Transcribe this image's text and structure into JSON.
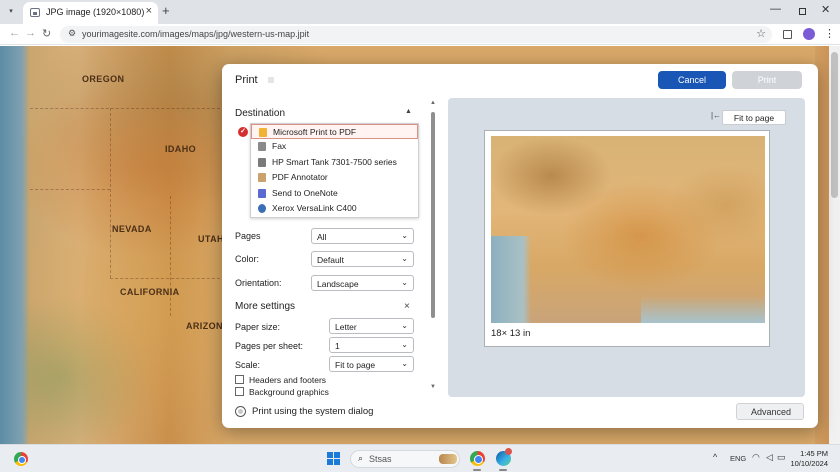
{
  "browser": {
    "tab_title": "JPG image (1920×1080)",
    "url": "yourimagesite.com/images/maps/jpg/western-us-map.jpit"
  },
  "map": {
    "states": [
      "OREGON",
      "IDAHO",
      "NEVADA",
      "UTAH",
      "CALIFORNIA",
      "ARIZONA"
    ]
  },
  "dialog": {
    "title": "Print",
    "cancel_label": "Cancel",
    "print_label": "Print",
    "destination": {
      "heading": "Destination",
      "items": [
        {
          "label": "Microsoft Print to PDF",
          "icon": "pdf-folder-icon",
          "color": "#f2b233"
        },
        {
          "label": "Fax",
          "icon": "fax-icon",
          "color": "#8a8a8a"
        },
        {
          "label": "HP Smart Tank 7301-7500 series",
          "icon": "printer-icon",
          "color": "#7a7a7a"
        },
        {
          "label": "PDF Annotator",
          "icon": "document-icon",
          "color": "#c9a36b"
        },
        {
          "label": "Send to OneNote",
          "icon": "onenote-icon",
          "color": "#5b6ad1"
        },
        {
          "label": "Xerox VersaLink C400",
          "icon": "printer-network-icon",
          "color": "#3b6fb3"
        }
      ]
    },
    "pages": {
      "label": "Pages",
      "value": "All"
    },
    "color": {
      "label": "Color:",
      "value": "Default"
    },
    "orientation": {
      "label": "Orientation:",
      "value": "Landscape"
    },
    "more_settings": {
      "heading": "More settings",
      "paper_size": {
        "label": "Paper size:",
        "value": "Letter"
      },
      "pages_per_sheet": {
        "label": "Pages per sheet:",
        "value": "1"
      },
      "scale": {
        "label": "Scale:",
        "value": "Fit to page"
      },
      "headers_footers": {
        "label": "Headers and footers",
        "checked": false
      },
      "background_graphics": {
        "label": "Background graphics",
        "checked": false
      }
    },
    "system_dialog_label": "Print using the system dialog",
    "preview": {
      "fit_label": "Fit to page",
      "size_label": "18× 13 in"
    },
    "advanced_label": "Advanced"
  },
  "taskbar": {
    "search_label": "Stsas",
    "language": "ENG",
    "time": "1:45 PM",
    "date": "10/10/2024"
  },
  "colors": {
    "accent": "#1a56b5",
    "selected_border": "#d99085",
    "check": "#d32f2f"
  }
}
